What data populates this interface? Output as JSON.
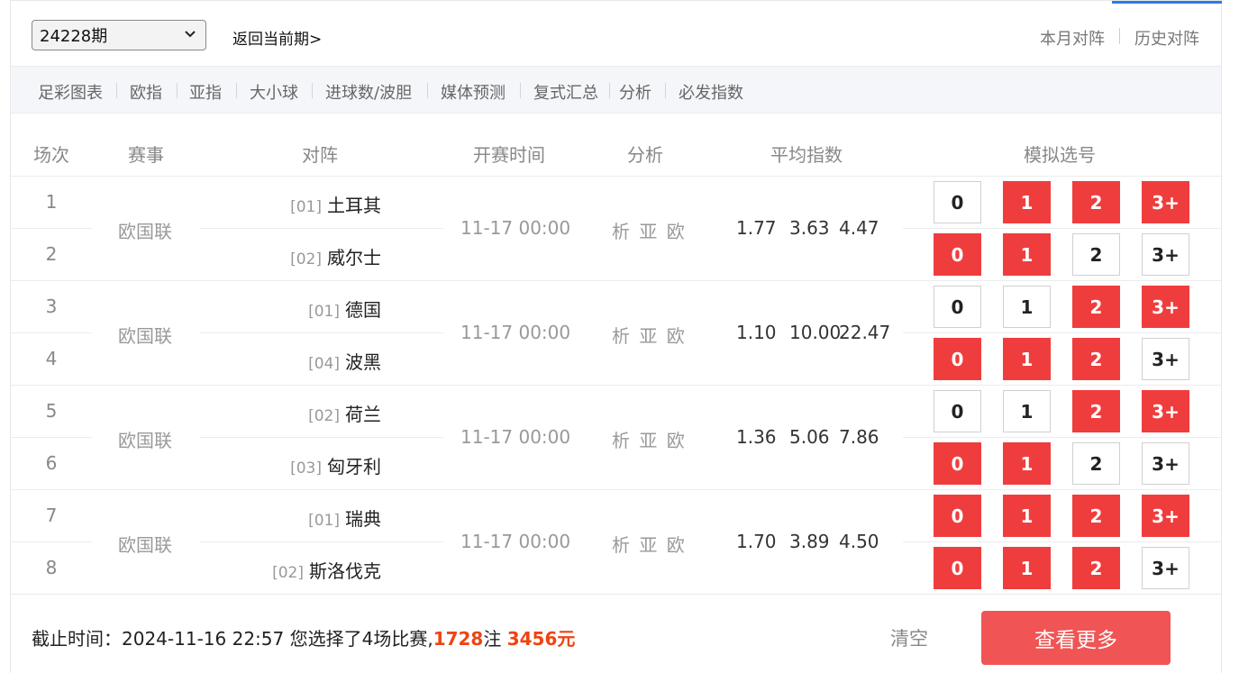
{
  "header": {
    "issue": "24228期",
    "back_link": "返回当前期>",
    "links": [
      "本月对阵",
      "历史对阵"
    ]
  },
  "nav": [
    "足彩图表",
    "欧指",
    "亚指",
    "大小球",
    "进球数/波胆",
    "媒体预测",
    "复式汇总",
    "分析",
    "必发指数"
  ],
  "table": {
    "headers": [
      "场次",
      "赛事",
      "对阵",
      "开赛时间",
      "分析",
      "平均指数",
      "模拟选号"
    ],
    "choices": [
      "0",
      "1",
      "2",
      "3+"
    ],
    "matches": [
      {
        "league": "欧国联",
        "time": "11-17 00:00",
        "analysis": "析 亚 欧",
        "odds": [
          "1.77",
          "3.63",
          "4.47"
        ],
        "teams": [
          {
            "idx": "1",
            "code": "[01]",
            "name": "土耳其",
            "selected": [
              false,
              true,
              true,
              true
            ]
          },
          {
            "idx": "2",
            "code": "[02]",
            "name": "威尔士",
            "selected": [
              true,
              true,
              false,
              false
            ]
          }
        ]
      },
      {
        "league": "欧国联",
        "time": "11-17 00:00",
        "analysis": "析 亚 欧",
        "odds": [
          "1.10",
          "10.00",
          "22.47"
        ],
        "teams": [
          {
            "idx": "3",
            "code": "[01]",
            "name": "德国",
            "selected": [
              false,
              false,
              true,
              true
            ]
          },
          {
            "idx": "4",
            "code": "[04]",
            "name": "波黑",
            "selected": [
              true,
              true,
              true,
              false
            ]
          }
        ]
      },
      {
        "league": "欧国联",
        "time": "11-17 00:00",
        "analysis": "析 亚 欧",
        "odds": [
          "1.36",
          "5.06",
          "7.86"
        ],
        "teams": [
          {
            "idx": "5",
            "code": "[02]",
            "name": "荷兰",
            "selected": [
              false,
              false,
              true,
              true
            ]
          },
          {
            "idx": "6",
            "code": "[03]",
            "name": "匈牙利",
            "selected": [
              true,
              true,
              false,
              false
            ]
          }
        ]
      },
      {
        "league": "欧国联",
        "time": "11-17 00:00",
        "analysis": "析 亚 欧",
        "odds": [
          "1.70",
          "3.89",
          "4.50"
        ],
        "teams": [
          {
            "idx": "7",
            "code": "[01]",
            "name": "瑞典",
            "selected": [
              true,
              true,
              true,
              true
            ]
          },
          {
            "idx": "8",
            "code": "[02]",
            "name": "斯洛伐克",
            "selected": [
              true,
              true,
              true,
              false
            ]
          }
        ]
      }
    ]
  },
  "footer": {
    "deadline_label": "截止时间：",
    "deadline": "2024-11-16 22:57",
    "selected_text_a": "您选择了4场比赛,",
    "bets": "1728",
    "bets_unit": "注",
    "amount": "3456元",
    "clear": "清空",
    "more": "查看更多"
  },
  "colors": {
    "selected": "#ef3d3d",
    "accent_tab": "#2c7be5",
    "highlight_text": "#ee4411",
    "more_button": "#f05454"
  }
}
